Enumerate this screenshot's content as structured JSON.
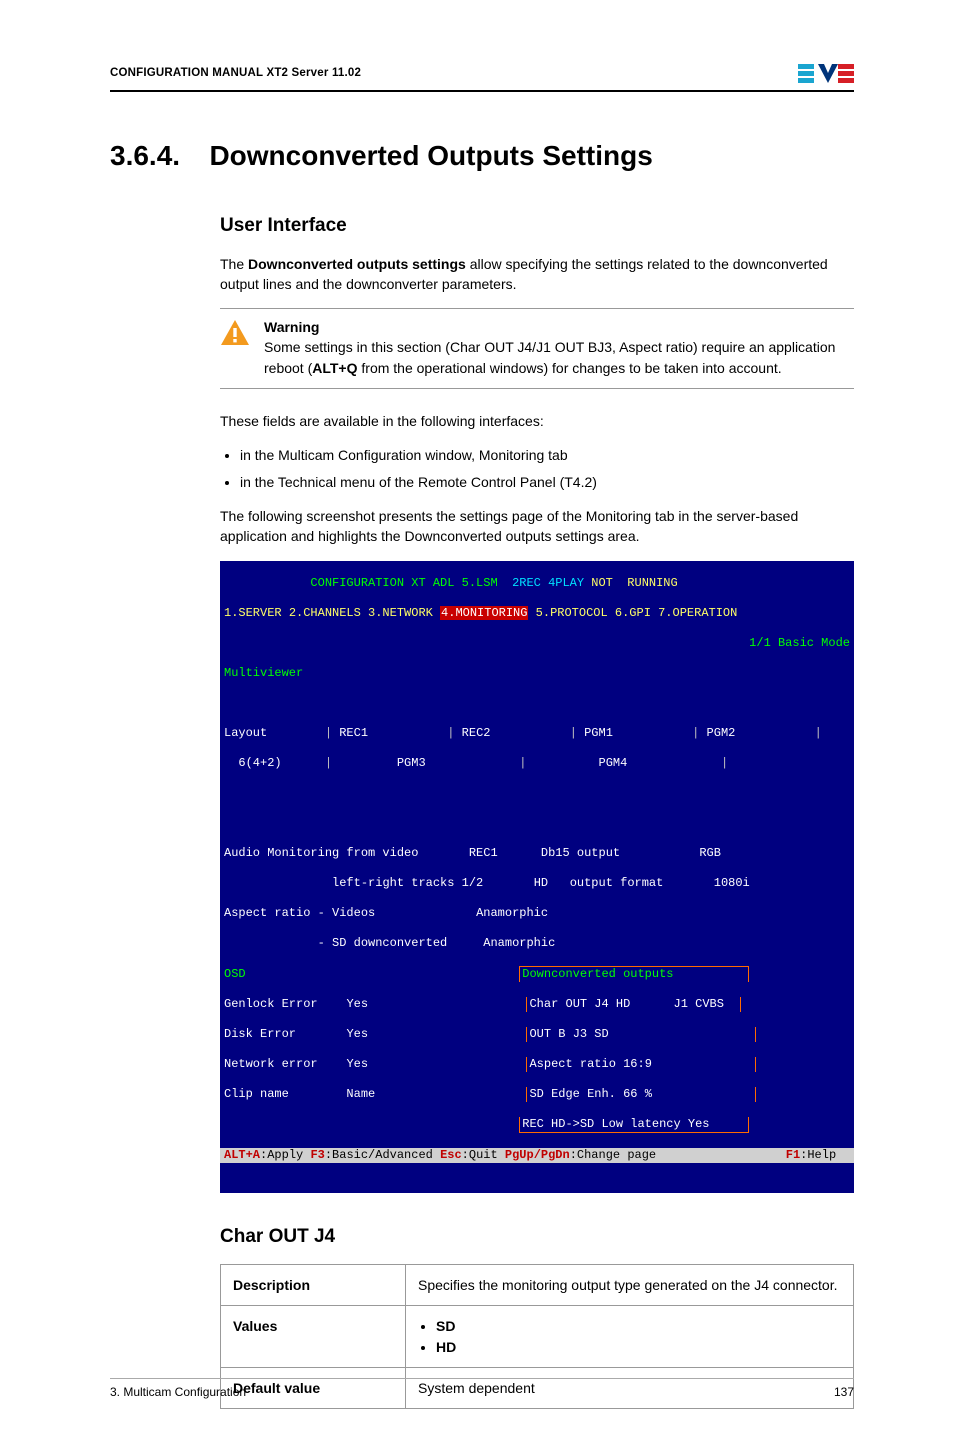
{
  "header": {
    "title": "CONFIGURATION MANUAL XT2 Server 11.02"
  },
  "section": {
    "number": "3.6.4.",
    "title": "Downconverted Outputs Settings"
  },
  "ui": {
    "h2": "User Interface",
    "p1a": "The ",
    "p1b": "Downconverted outputs settings",
    "p1c": " allow specifying the settings related to the downconverted output lines and the downconverter parameters.",
    "warn_title": "Warning",
    "warn_a": "Some settings in this section (Char OUT J4/J1 OUT BJ3, Aspect ratio) require an application reboot (",
    "warn_b": "ALT+Q",
    "warn_c": " from the operational windows) for changes to be taken into account.",
    "p2": "These fields are available in the following interfaces:",
    "li1": "in the Multicam Configuration window, Monitoring tab",
    "li2": "in the Technical menu of the Remote Control Panel (T4.2)",
    "p3": "The following screenshot presents the settings page of the Monitoring tab in the server-based application and highlights the Downconverted outputs settings area."
  },
  "term": {
    "title_left": "CONFIGURATION XT ADL 5.LSM",
    "title_mid": "2REC 4PLAY",
    "title_right": "NOT  RUNNING",
    "tabs": {
      "t1": "1.SERVER",
      "t2": "2.CHANNELS",
      "t3": "3.NETWORK",
      "t4": "4.MONITORING",
      "t5": "5.PROTOCOL",
      "t6": "6.GPI",
      "t7": "7.OPERATION"
    },
    "mode": "1/1 Basic Mode",
    "multiviewer": "Multiviewer",
    "layout": "Layout",
    "layout_val": "6(4+2)",
    "rec1": "REC1",
    "rec2": "REC2",
    "pgm1": "PGM1",
    "pgm2": "PGM2",
    "pgm3": "PGM3",
    "pgm4": "PGM4",
    "audio_mon": "Audio Monitoring from video",
    "audio_mon_v": "REC1",
    "db15": "Db15 output",
    "db15_v": "RGB",
    "lrtracks": "left-right tracks",
    "lrtracks_v": "1/2",
    "outfmt_l": "HD",
    "outfmt": "output format",
    "outfmt_v": "1080i",
    "asp": "Aspect ratio - Videos",
    "asp_v": "Anamorphic",
    "asp2": "- SD downconverted",
    "asp2_v": "Anamorphic",
    "osd": "OSD",
    "genlock": "Genlock Error",
    "genlock_v": "Yes",
    "disk": "Disk Error",
    "disk_v": "Yes",
    "net": "Network error",
    "net_v": "Yes",
    "clip": "Clip name",
    "clip_v": "Name",
    "dc_title": "Downconverted outputs",
    "dc1": "Char OUT J4 HD",
    "dc1r": "J1 CVBS",
    "dc2": "OUT B J3 SD",
    "dc3": "Aspect ratio 16:9",
    "dc4": "SD Edge Enh. 66 %",
    "dc5": "REC HD->SD Low latency Yes",
    "foot_alt": "ALT+A",
    "foot_apply": ":Apply ",
    "foot_f3": "F3",
    "foot_basic": ":Basic/Advanced ",
    "foot_esc": "Esc",
    "foot_quit": ":Quit ",
    "foot_pg": "PgUp/PgDn",
    "foot_chg": ":Change page",
    "foot_f1": "F1",
    "foot_help": ":Help"
  },
  "char": {
    "h2": "Char OUT J4",
    "r1k": "Description",
    "r1v": "Specifies the monitoring output type generated on the J4 connector.",
    "r2k": "Values",
    "r2v1": "SD",
    "r2v2": "HD",
    "r3k": "Default value",
    "r3v": "System dependent"
  },
  "footer": {
    "left": "3. Multicam Configuration",
    "right": "137"
  }
}
